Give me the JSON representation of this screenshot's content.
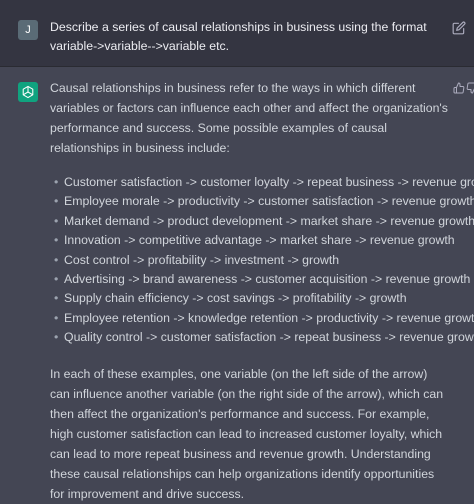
{
  "user_message": {
    "avatar_letter": "J",
    "text": "Describe a series of causal relationships in business using the format variable->variable-->variable etc."
  },
  "assistant_message": {
    "intro": "Causal relationships in business refer to the ways in which different variables or factors can influence each other and affect the organization's performance and success. Some possible examples of causal relationships in business include:",
    "examples": [
      "Customer satisfaction -> customer loyalty -> repeat business -> revenue growth",
      "Employee morale -> productivity -> customer satisfaction -> revenue growth",
      "Market demand -> product development -> market share -> revenue growth",
      "Innovation -> competitive advantage -> market share -> revenue growth",
      "Cost control -> profitability -> investment -> growth",
      "Advertising -> brand awareness -> customer acquisition -> revenue growth",
      "Supply chain efficiency -> cost savings -> profitability -> growth",
      "Employee retention -> knowledge retention -> productivity -> revenue growth",
      "Quality control -> customer satisfaction -> repeat business -> revenue growth"
    ],
    "conclusion": "In each of these examples, one variable (on the left side of the arrow) can influence another variable (on the right side of the arrow), which can then affect the organization's performance and success. For example, high customer satisfaction can lead to increased customer loyalty, which can lead to more repeat business and revenue growth. Understanding these causal relationships can help organizations identify opportunities for improvement and drive success."
  },
  "icons": {
    "user_avatar": "user-avatar",
    "assistant_avatar": "openai-logo-icon",
    "edit": "edit-icon",
    "thumbs_up": "thumbs-up-icon",
    "thumbs_down": "thumbs-down-icon"
  },
  "colors": {
    "user_bg": "#343541",
    "assistant_bg": "#444654",
    "text": "#d1d5db",
    "accent": "#10a37f",
    "user_avatar_bg": "#5a6b76"
  }
}
